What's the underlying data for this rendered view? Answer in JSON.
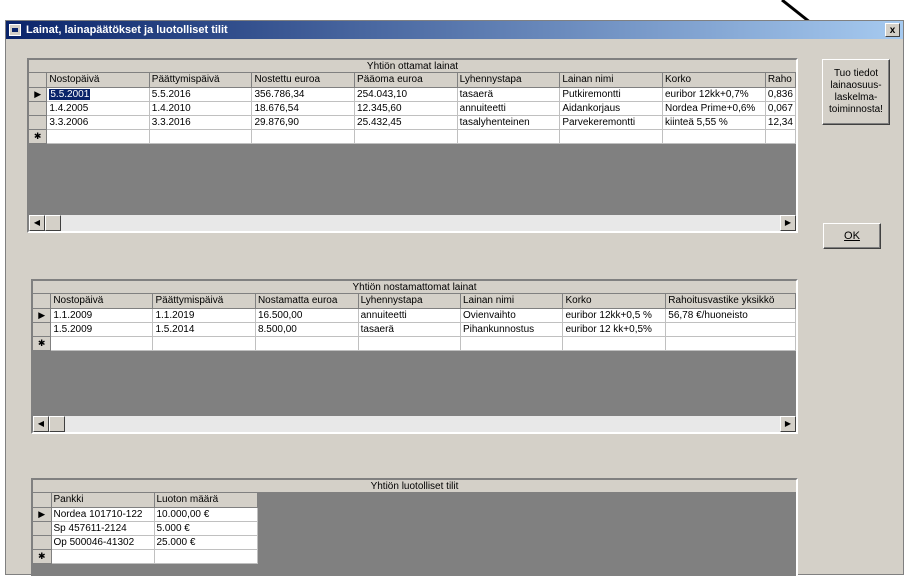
{
  "window": {
    "title": "Lainat, lainapäätökset ja luotolliset tilit",
    "close_label": "x"
  },
  "buttons": {
    "fetch_label": "Tuo tiedot lainaosuus-laskelma-toiminnosta!",
    "ok_label": "OK"
  },
  "grid1": {
    "caption": "Yhtiön ottamat lainat",
    "columns": [
      "Nostopäivä",
      "Päättymispäivä",
      "Nostettu euroa",
      "Pääoma euroa",
      "Lyhennystapa",
      "Lainan nimi",
      "Korko",
      "Raho"
    ],
    "rows": [
      [
        "5.5.2001",
        "5.5.2016",
        "356.786,34",
        "254.043,10",
        "tasaerä",
        "Putkiremontti",
        "euribor 12kk+0,7%",
        "0,836"
      ],
      [
        "1.4.2005",
        "1.4.2010",
        "18.676,54",
        "12.345,60",
        "annuiteetti",
        "Aidankorjaus",
        "Nordea Prime+0,6%",
        "0,067"
      ],
      [
        "3.3.2006",
        "3.3.2016",
        "29.876,90",
        "25.432,45",
        "tasalyhenteinen",
        "Parvekeremontti",
        "kiinteä 5,55 %",
        "12,34"
      ]
    ]
  },
  "grid2": {
    "caption": "Yhtiön nostamattomat lainat",
    "columns": [
      "Nostopäivä",
      "Päättymispäivä",
      "Nostamatta euroa",
      "Lyhennystapa",
      "Lainan nimi",
      "Korko",
      "Rahoitusvastike yksikkö"
    ],
    "rows": [
      [
        "1.1.2009",
        "1.1.2019",
        "16.500,00",
        "annuiteetti",
        "Ovienvaihto",
        "euribor 12kk+0,5 %",
        "56,78 €/huoneisto"
      ],
      [
        "1.5.2009",
        "1.5.2014",
        "8.500,00",
        "tasaerä",
        "Pihankunnostus",
        "euribor 12 kk+0,5%",
        ""
      ]
    ]
  },
  "grid3": {
    "caption": "Yhtiön luotolliset tilit",
    "columns": [
      "Pankki",
      "Luoton määrä"
    ],
    "rows": [
      [
        "Nordea 101710-122",
        "10.000,00 €"
      ],
      [
        "Sp 457611-2124",
        "5.000 €"
      ],
      [
        "Op 500046-41302",
        "25.000 €"
      ]
    ]
  },
  "icons": {
    "current_row": "▶",
    "new_row": "✱",
    "left": "◀",
    "right": "▶"
  }
}
